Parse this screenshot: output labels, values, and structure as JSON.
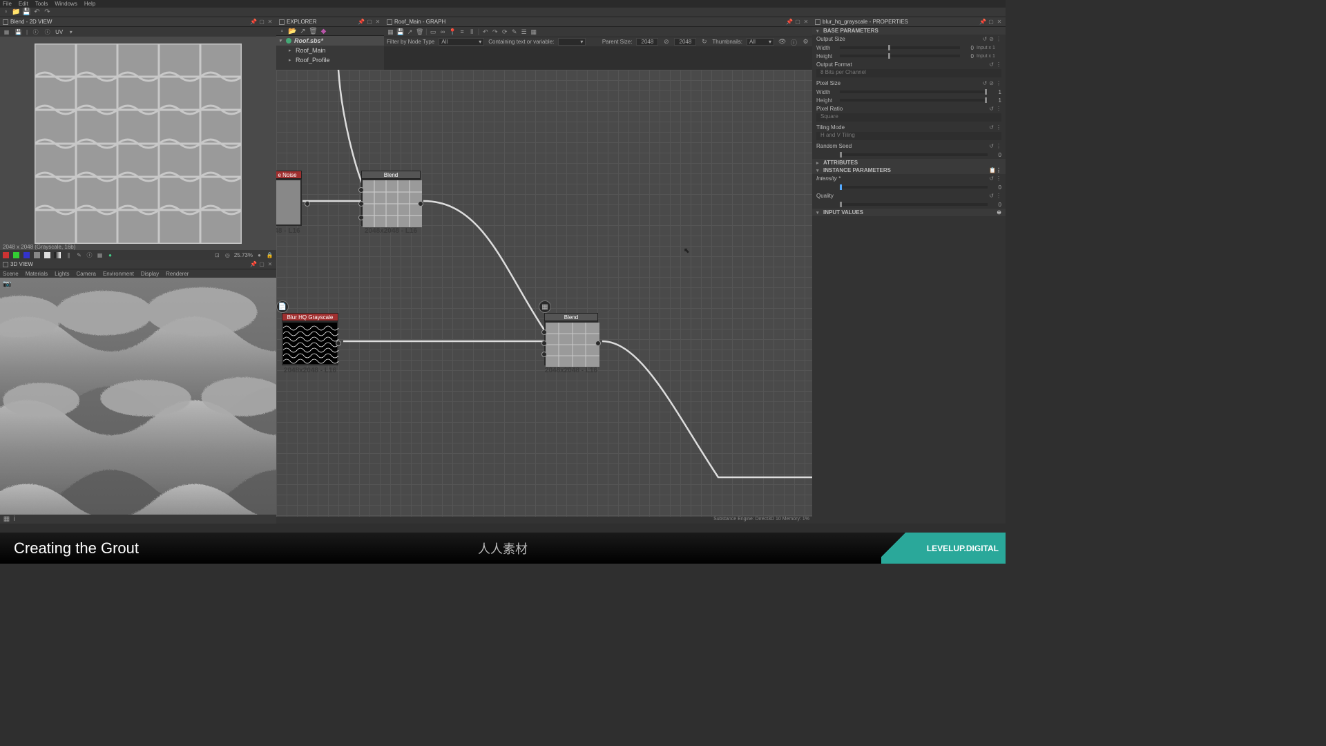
{
  "menu": {
    "file": "File",
    "edit": "Edit",
    "tools": "Tools",
    "windows": "Windows",
    "help": "Help"
  },
  "panel2d": {
    "title": "Blend  -  2D VIEW",
    "uv_label": "UV",
    "status": "2048 x 2048  (Grayscale, 16b)",
    "zoom": "25.73%"
  },
  "panel3d": {
    "title": "3D VIEW",
    "menus": {
      "scene": "Scene",
      "materials": "Materials",
      "lights": "Lights",
      "camera": "Camera",
      "environment": "Environment",
      "display": "Display",
      "renderer": "Renderer"
    }
  },
  "explorer": {
    "title": "EXPLORER",
    "root": "Roof.sbs*",
    "children": [
      "Roof_Main",
      "Roof_Profile"
    ]
  },
  "graph": {
    "title": "Roof_Main  -  GRAPH",
    "filter_type_label": "Filter by Node Type",
    "filter_type_value": "All",
    "filter_var_label": "Containing text or variable:",
    "parent_size_label": "Parent Size:",
    "parent_w": "2048",
    "parent_h": "2048",
    "thumb_label": "Thumbnails:",
    "thumb_value": "All",
    "nodes": {
      "n1_label": "e Noise",
      "n1_caption": "48 - L16",
      "n2_label": "Blend",
      "n2_caption": "2048x2048 - L16",
      "n3_label": "Blur HQ Grayscale",
      "n3_caption": "2048x2048 - L16",
      "n4_label": "Blend",
      "n4_caption": "2048x2048 - L16"
    },
    "status": "Substance Engine: Direct3D 10   Memory: 1%"
  },
  "properties": {
    "title": "blur_hq_grayscale - PROPERTIES",
    "sections": {
      "base": "BASE PARAMETERS",
      "output_size": "Output Size",
      "width": "Width",
      "height": "Height",
      "w_val": "0",
      "h_val": "0",
      "unit": "Input x 1",
      "output_format": "Output Format",
      "format_val": "8 Bits per Channel",
      "pixel_size": "Pixel Size",
      "ps_w": "1",
      "ps_h": "1",
      "pixel_ratio": "Pixel Ratio",
      "ratio_val": "Square",
      "tiling_mode": "Tiling Mode",
      "tiling_val": "H and V Tiling",
      "random_seed": "Random Seed",
      "seed_val": "0",
      "attributes": "ATTRIBUTES",
      "instance": "INSTANCE PARAMETERS",
      "intensity": "Intensity *",
      "intensity_val": "0",
      "quality": "Quality",
      "quality_val": "0",
      "input_values": "INPUT VALUES"
    }
  },
  "footer": {
    "title": "Creating the Grout",
    "brand": "LEVELUP.DIGITAL",
    "watermark": "人人素材"
  }
}
